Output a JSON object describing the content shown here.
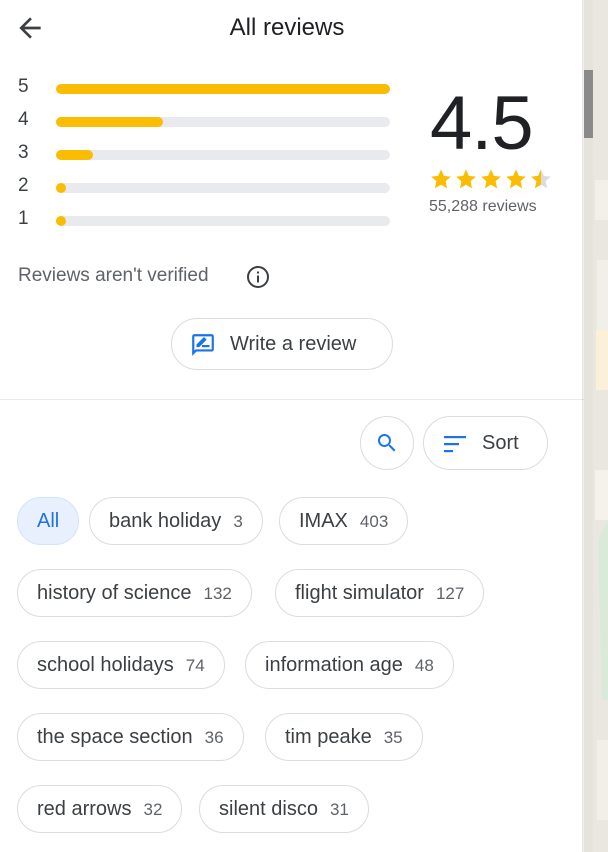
{
  "header": {
    "title": "All reviews",
    "back_icon": "back-arrow-icon"
  },
  "ratings": {
    "score": "4.5",
    "stars": 4.5,
    "review_count": "55,288 reviews",
    "star_color": "#fbbc04",
    "histogram": [
      {
        "label": "5",
        "fraction": 1.0
      },
      {
        "label": "4",
        "fraction": 0.32
      },
      {
        "label": "3",
        "fraction": 0.11
      },
      {
        "label": "2",
        "fraction": 0.03
      },
      {
        "label": "1",
        "fraction": 0.025
      }
    ]
  },
  "verification": {
    "text": "Reviews aren't verified",
    "icon": "info-icon"
  },
  "write_review": {
    "label": "Write a review",
    "icon": "rate-review-icon"
  },
  "toolbar": {
    "search_icon": "search-icon",
    "sort_label": "Sort",
    "sort_icon": "sort-icon"
  },
  "accent_color": "#1a73e8",
  "topics": [
    {
      "label": "All",
      "count": "",
      "active": true
    },
    {
      "label": "bank holiday",
      "count": "3"
    },
    {
      "label": "IMAX",
      "count": "403"
    },
    {
      "label": "history of science",
      "count": "132"
    },
    {
      "label": "flight simulator",
      "count": "127"
    },
    {
      "label": "school holidays",
      "count": "74"
    },
    {
      "label": "information age",
      "count": "48"
    },
    {
      "label": "the space section",
      "count": "36"
    },
    {
      "label": "tim peake",
      "count": "35"
    },
    {
      "label": "red arrows",
      "count": "32"
    },
    {
      "label": "silent disco",
      "count": "31"
    }
  ]
}
